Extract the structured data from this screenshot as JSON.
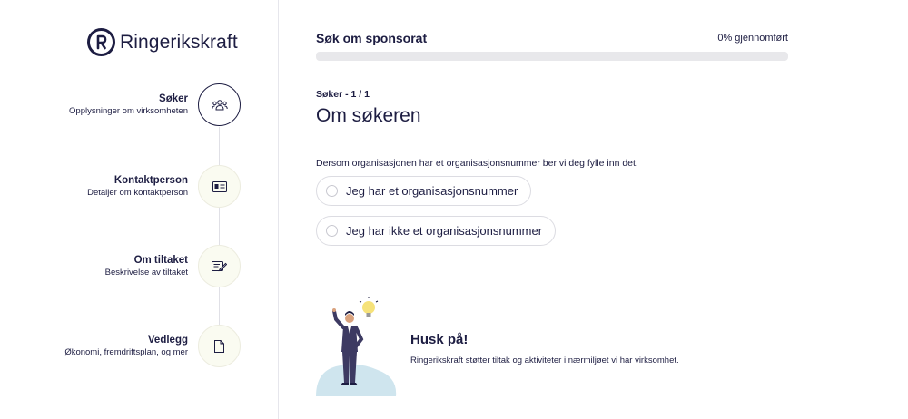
{
  "brand": {
    "name": "Ringerikskraft"
  },
  "steps": [
    {
      "title": "Søker",
      "subtitle": "Opplysninger om virksomheten",
      "icon": "users-icon",
      "active": true
    },
    {
      "title": "Kontaktperson",
      "subtitle": "Detaljer om kontaktperson",
      "icon": "id-card-icon",
      "active": false
    },
    {
      "title": "Om tiltaket",
      "subtitle": "Beskrivelse av tiltaket",
      "icon": "edit-document-icon",
      "active": false
    },
    {
      "title": "Vedlegg",
      "subtitle": "Økonomi, fremdriftsplan, og mer",
      "icon": "file-icon",
      "active": false
    }
  ],
  "progress": {
    "title": "Søk om sponsorat",
    "label": "0% gjennomført",
    "value": 0
  },
  "section": {
    "label": "Søker - 1 / 1",
    "title": "Om søkeren"
  },
  "question": {
    "text": "Dersom organisasjonen har et organisasjonsnummer ber vi deg fylle inn det."
  },
  "options": [
    {
      "label": "Jeg har et organisasjonsnummer",
      "selected": false
    },
    {
      "label": "Jeg har ikke et organisasjonsnummer",
      "selected": false
    }
  ],
  "hint": {
    "title": "Husk på!",
    "text": "Ringerikskraft støtter tiltak og aktiviteter i nærmiljøet vi har virksomhet."
  },
  "colors": {
    "navy": "#1d1d42",
    "track": "#e8e8eb",
    "circle_bg": "#fafbf1",
    "illustration_blob": "#cfe5ee",
    "bulb": "#f6e27a"
  }
}
